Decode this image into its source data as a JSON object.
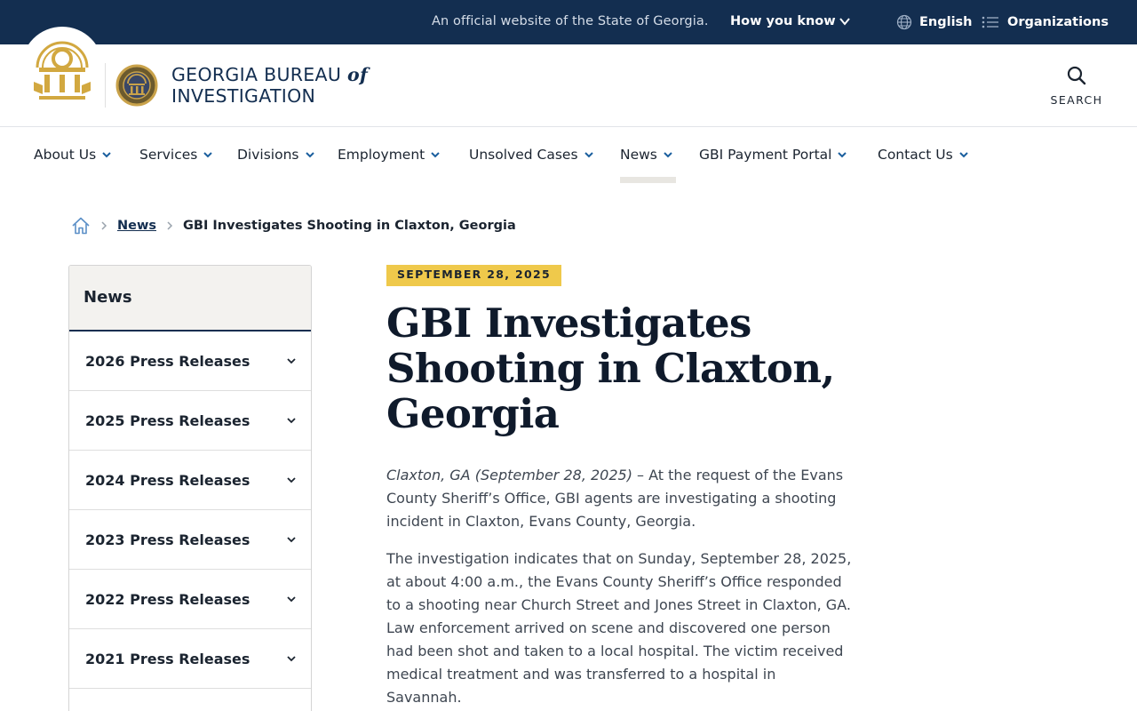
{
  "banner": {
    "official_text": "An official website of the State of Georgia.",
    "how_you_know": "How you know",
    "language": "English",
    "organizations": "Organizations"
  },
  "header": {
    "agency_line1": "GEORGIA BUREAU",
    "agency_of": "of",
    "agency_line2": "INVESTIGATION",
    "search_label": "SEARCH"
  },
  "nav": {
    "items": [
      {
        "label": "About Us"
      },
      {
        "label": "Services"
      },
      {
        "label": "Divisions"
      },
      {
        "label": "Employment"
      },
      {
        "label": "Unsolved Cases"
      },
      {
        "label": "News",
        "active": true
      },
      {
        "label": "GBI Payment Portal"
      },
      {
        "label": "Contact Us"
      }
    ]
  },
  "breadcrumb": {
    "link": "News",
    "current": "GBI Investigates Shooting in Claxton, Georgia"
  },
  "sidebar": {
    "heading": "News",
    "items": [
      {
        "label": "2026 Press Releases"
      },
      {
        "label": "2025 Press Releases"
      },
      {
        "label": "2024 Press Releases"
      },
      {
        "label": "2023 Press Releases"
      },
      {
        "label": "2022 Press Releases"
      },
      {
        "label": "2021 Press Releases"
      }
    ]
  },
  "article": {
    "date": "SEPTEMBER 28, 2025",
    "title": "GBI Investigates Shooting in Claxton, Georgia",
    "dateline": "Claxton, GA (September 28, 2025)",
    "p1_rest": " – At the request of the Evans County Sheriff’s Office, GBI agents are investigating a shooting incident in Claxton, Evans County, Georgia.",
    "p2": "The investigation indicates that on Sunday, September 28, 2025, at about 4:00 a.m., the Evans County Sheriff’s Office responded to a shooting near Church Street and Jones Street in Claxton, GA. Law enforcement arrived on scene and discovered one person had been shot and taken to a local hospital. The victim received medical treatment and was transferred to a hospital in Savannah."
  },
  "colors": {
    "navy": "#132e50",
    "gold_badge": "#efc94b",
    "seal_gold": "#d2a840"
  },
  "icons": {
    "how_you_know": "chevron-down-icon",
    "language": "globe-icon",
    "organizations": "list-icon",
    "search": "search-icon",
    "breadcrumb_home": "home-icon",
    "breadcrumb_sep": "chevron-right-icon"
  }
}
